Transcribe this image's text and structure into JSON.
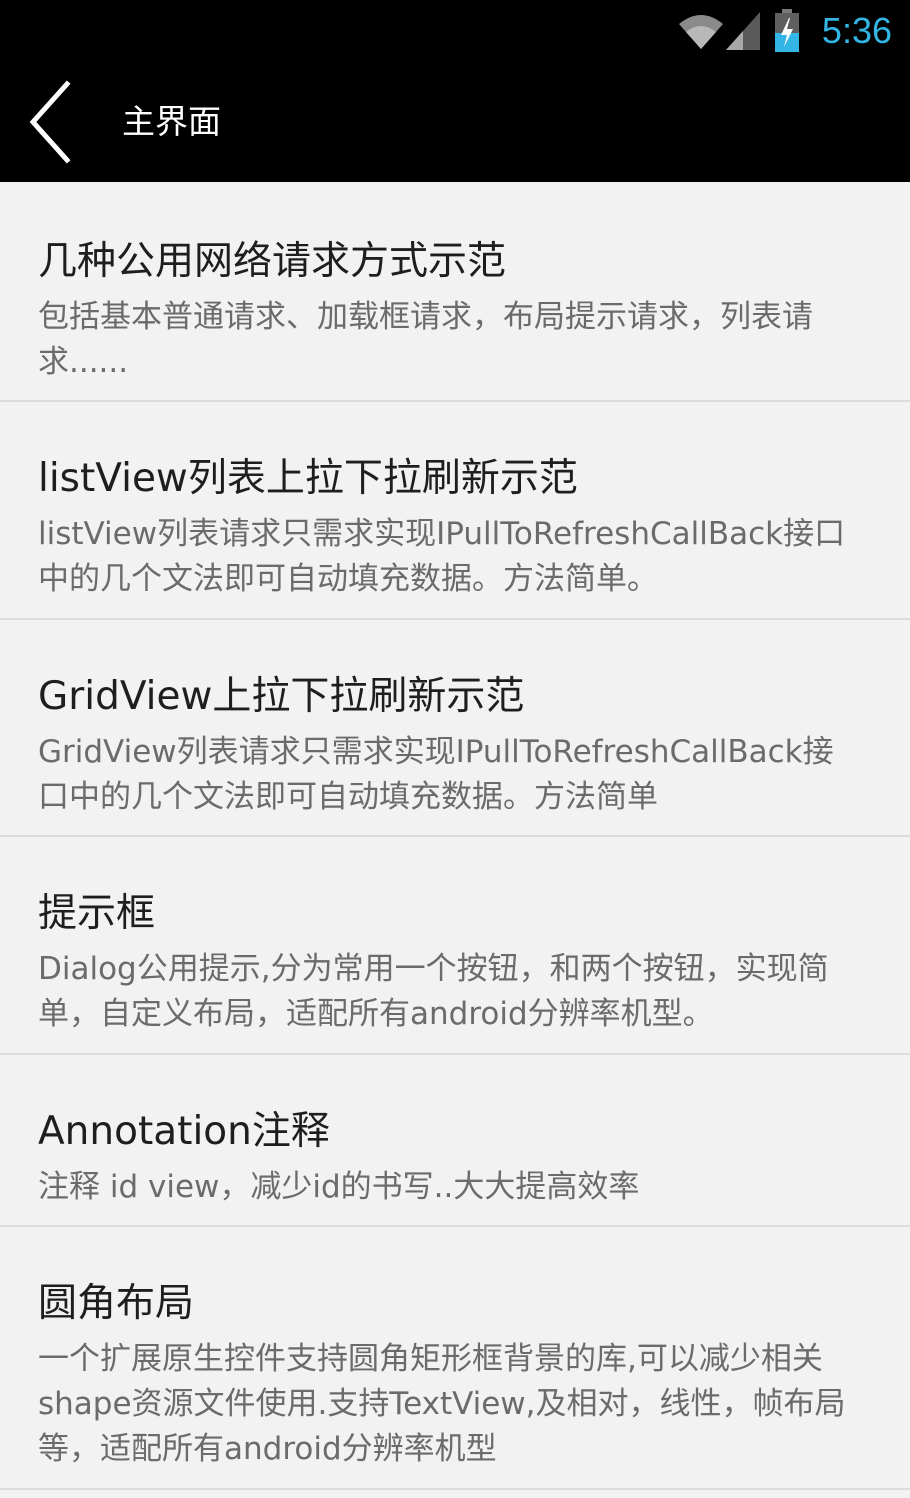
{
  "status_bar": {
    "time": "5:36",
    "icons": [
      "wifi-icon",
      "signal-icon",
      "battery-charging-icon"
    ],
    "accent_color": "#33b5e5"
  },
  "action_bar": {
    "back_icon": "chevron-left-icon",
    "title": "主界面",
    "background": "#000000"
  },
  "items": [
    {
      "title": "几种公用网络请求方式示范",
      "description": "包括基本普通请求、加载框请求，布局提示请求，列表请求......"
    },
    {
      "title": "listView列表上拉下拉刷新示范",
      "description": "listView列表请求只需求实现IPullToRefreshCallBack接口中的几个文法即可自动填充数据。方法简单。"
    },
    {
      "title": "GridView上拉下拉刷新示范",
      "description": "GridView列表请求只需求实现IPullToRefreshCallBack接口中的几个文法即可自动填充数据。方法简单"
    },
    {
      "title": "提示框",
      "description": "Dialog公用提示,分为常用一个按钮，和两个按钮，实现简单，自定义布局，适配所有android分辨率机型。"
    },
    {
      "title": "Annotation注释",
      "description": "注释 id view，减少id的书写..大大提高效率"
    },
    {
      "title": "圆角布局",
      "description": "一个扩展原生控件支持圆角矩形框背景的库,可以减少相关shape资源文件使用.支持TextView,及相对，线性，帧布局等，适配所有android分辨率机型"
    }
  ]
}
